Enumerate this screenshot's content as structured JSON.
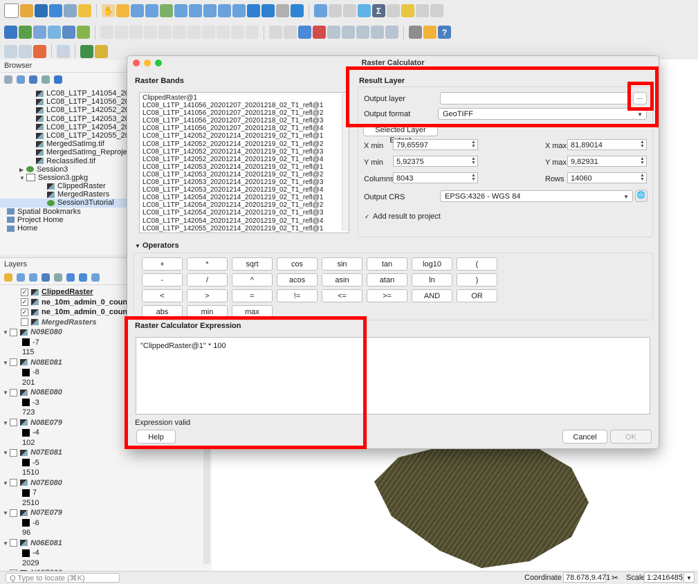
{
  "browser": {
    "title": "Browser",
    "items": [
      {
        "label": "LC08_L1TP_141054_202",
        "indent": 52,
        "type": "raster"
      },
      {
        "label": "LC08_L1TP_141056_202",
        "indent": 52,
        "type": "raster"
      },
      {
        "label": "LC08_L1TP_142052_202",
        "indent": 52,
        "type": "raster"
      },
      {
        "label": "LC08_L1TP_142053_202",
        "indent": 52,
        "type": "raster"
      },
      {
        "label": "LC08_L1TP_142054_202",
        "indent": 52,
        "type": "raster"
      },
      {
        "label": "LC08_L1TP_142055_202",
        "indent": 52,
        "type": "raster"
      },
      {
        "label": "MergedSatImg.tif",
        "indent": 52,
        "type": "raster"
      },
      {
        "label": "MergedSatImg_Reproject",
        "indent": 52,
        "type": "raster"
      },
      {
        "label": "Reclassified.tif",
        "indent": 52,
        "type": "raster"
      },
      {
        "label": "Session3",
        "indent": 40,
        "type": "qgs",
        "arrow": "▶"
      },
      {
        "label": "Session3.gpkg",
        "indent": 40,
        "type": "gpkg",
        "arrow": "▼"
      },
      {
        "label": "ClippedRaster",
        "indent": 68,
        "type": "raster"
      },
      {
        "label": "MergedRasters",
        "indent": 68,
        "type": "raster"
      },
      {
        "label": "Session3Tutorial",
        "indent": 68,
        "type": "qgs",
        "selected": true
      },
      {
        "label": "Spatial Bookmarks",
        "indent": 10,
        "type": "bookmark"
      },
      {
        "label": "Project Home",
        "indent": 10,
        "type": "home"
      },
      {
        "label": "Home",
        "indent": 10,
        "type": "home"
      }
    ]
  },
  "layers": {
    "title": "Layers",
    "items": [
      {
        "label": "ClippedRaster",
        "kind": "layer",
        "checked": true,
        "bold": true,
        "underline": true
      },
      {
        "label": "ne_10m_admin_0_countr",
        "kind": "layer",
        "checked": true,
        "bold": true
      },
      {
        "label": "ne_10m_admin_0_countr",
        "kind": "layer",
        "checked": true,
        "bold": true
      },
      {
        "label": "MergedRasters",
        "kind": "layer",
        "checked": false,
        "italic": true
      },
      {
        "label": "N09E080",
        "kind": "group",
        "checked": false
      },
      {
        "label": "-7",
        "kind": "swatch"
      },
      {
        "label": "115",
        "kind": "value"
      },
      {
        "label": "N08E081",
        "kind": "group",
        "checked": false
      },
      {
        "label": "-8",
        "kind": "swatch"
      },
      {
        "label": "201",
        "kind": "value"
      },
      {
        "label": "N08E080",
        "kind": "group",
        "checked": false
      },
      {
        "label": "-3",
        "kind": "swatch"
      },
      {
        "label": "723",
        "kind": "value"
      },
      {
        "label": "N08E079",
        "kind": "group",
        "checked": false
      },
      {
        "label": "-4",
        "kind": "swatch"
      },
      {
        "label": "102",
        "kind": "value"
      },
      {
        "label": "N07E081",
        "kind": "group",
        "checked": false
      },
      {
        "label": "-5",
        "kind": "swatch"
      },
      {
        "label": "1510",
        "kind": "value"
      },
      {
        "label": "N07E080",
        "kind": "group",
        "checked": false
      },
      {
        "label": "7",
        "kind": "swatch"
      },
      {
        "label": "2510",
        "kind": "value"
      },
      {
        "label": "N07E079",
        "kind": "group",
        "checked": false
      },
      {
        "label": "-6",
        "kind": "swatch"
      },
      {
        "label": "96",
        "kind": "value"
      },
      {
        "label": "N06E081",
        "kind": "group",
        "checked": false
      },
      {
        "label": "-4",
        "kind": "swatch"
      },
      {
        "label": "2029",
        "kind": "value"
      },
      {
        "label": "N06E080",
        "kind": "group",
        "checked": false
      }
    ]
  },
  "status": {
    "locate_placeholder": "Q  Type to locate (⌘K)",
    "coordinate_label": "Coordinate",
    "coordinate_value": "78.678,9.471",
    "scale_label": "Scale",
    "scale_value": "1:2416485"
  },
  "dialog": {
    "title": "Raster Calculator",
    "raster_bands_title": "Raster Bands",
    "bands": [
      "ClippedRaster@1",
      "LC08_L1TP_141056_20201207_20201218_02_T1_refl@1",
      "LC08_L1TP_141056_20201207_20201218_02_T1_refl@2",
      "LC08_L1TP_141056_20201207_20201218_02_T1_refl@3",
      "LC08_L1TP_141056_20201207_20201218_02_T1_refl@4",
      "LC08_L1TP_142052_20201214_20201219_02_T1_refl@1",
      "LC08_L1TP_142052_20201214_20201219_02_T1_refl@2",
      "LC08_L1TP_142052_20201214_20201219_02_T1_refl@3",
      "LC08_L1TP_142052_20201214_20201219_02_T1_refl@4",
      "LC08_L1TP_142053_20201214_20201219_02_T1_refl@1",
      "LC08_L1TP_142053_20201214_20201219_02_T1_refl@2",
      "LC08_L1TP_142053_20201214_20201219_02_T1_refl@3",
      "LC08_L1TP_142053_20201214_20201219_02_T1_refl@4",
      "LC08_L1TP_142054_20201214_20201219_02_T1_refl@1",
      "LC08_L1TP_142054_20201214_20201219_02_T1_refl@2",
      "LC08_L1TP_142054_20201214_20201219_02_T1_refl@3",
      "LC08_L1TP_142054_20201214_20201219_02_T1_refl@4",
      "LC08_L1TP_142055_20201214_20201219_02_T1_refl@1"
    ],
    "result_layer_title": "Result Layer",
    "output_layer_label": "Output layer",
    "output_layer_value": "",
    "browse_label": "...",
    "output_format_label": "Output format",
    "output_format_value": "GeoTIFF",
    "selected_extent_label": "Selected Layer Extent",
    "xmin_label": "X min",
    "xmin_value": "79,65597",
    "xmax_label": "X max",
    "xmax_value": "81,89014",
    "ymin_label": "Y min",
    "ymin_value": "5,92375",
    "ymax_label": "Y max",
    "ymax_value": "9,82931",
    "columns_label": "Columns",
    "columns_value": "8043",
    "rows_label": "Rows",
    "rows_value": "14060",
    "crs_label": "Output CRS",
    "crs_value": "EPSG:4326 - WGS 84",
    "add_result_label": "Add result to project",
    "add_result_checked": true,
    "operators_title": "Operators",
    "operators": [
      [
        "+",
        "*",
        "sqrt",
        "cos",
        "sin",
        "tan",
        "log10",
        "("
      ],
      [
        "-",
        "/",
        "^",
        "acos",
        "asin",
        "atan",
        "ln",
        ")"
      ],
      [
        "<",
        ">",
        "=",
        "!=",
        "<=",
        ">=",
        "AND",
        "OR"
      ],
      [
        "abs",
        "min",
        "max"
      ]
    ],
    "expression_title": "Raster Calculator Expression",
    "expression": "\"ClippedRaster@1\" * 100",
    "expression_status": "Expression valid",
    "help_label": "Help",
    "cancel_label": "Cancel",
    "ok_label": "OK"
  },
  "colors": {
    "highlight": "#ff0000",
    "selection": "#cfe0f7"
  }
}
